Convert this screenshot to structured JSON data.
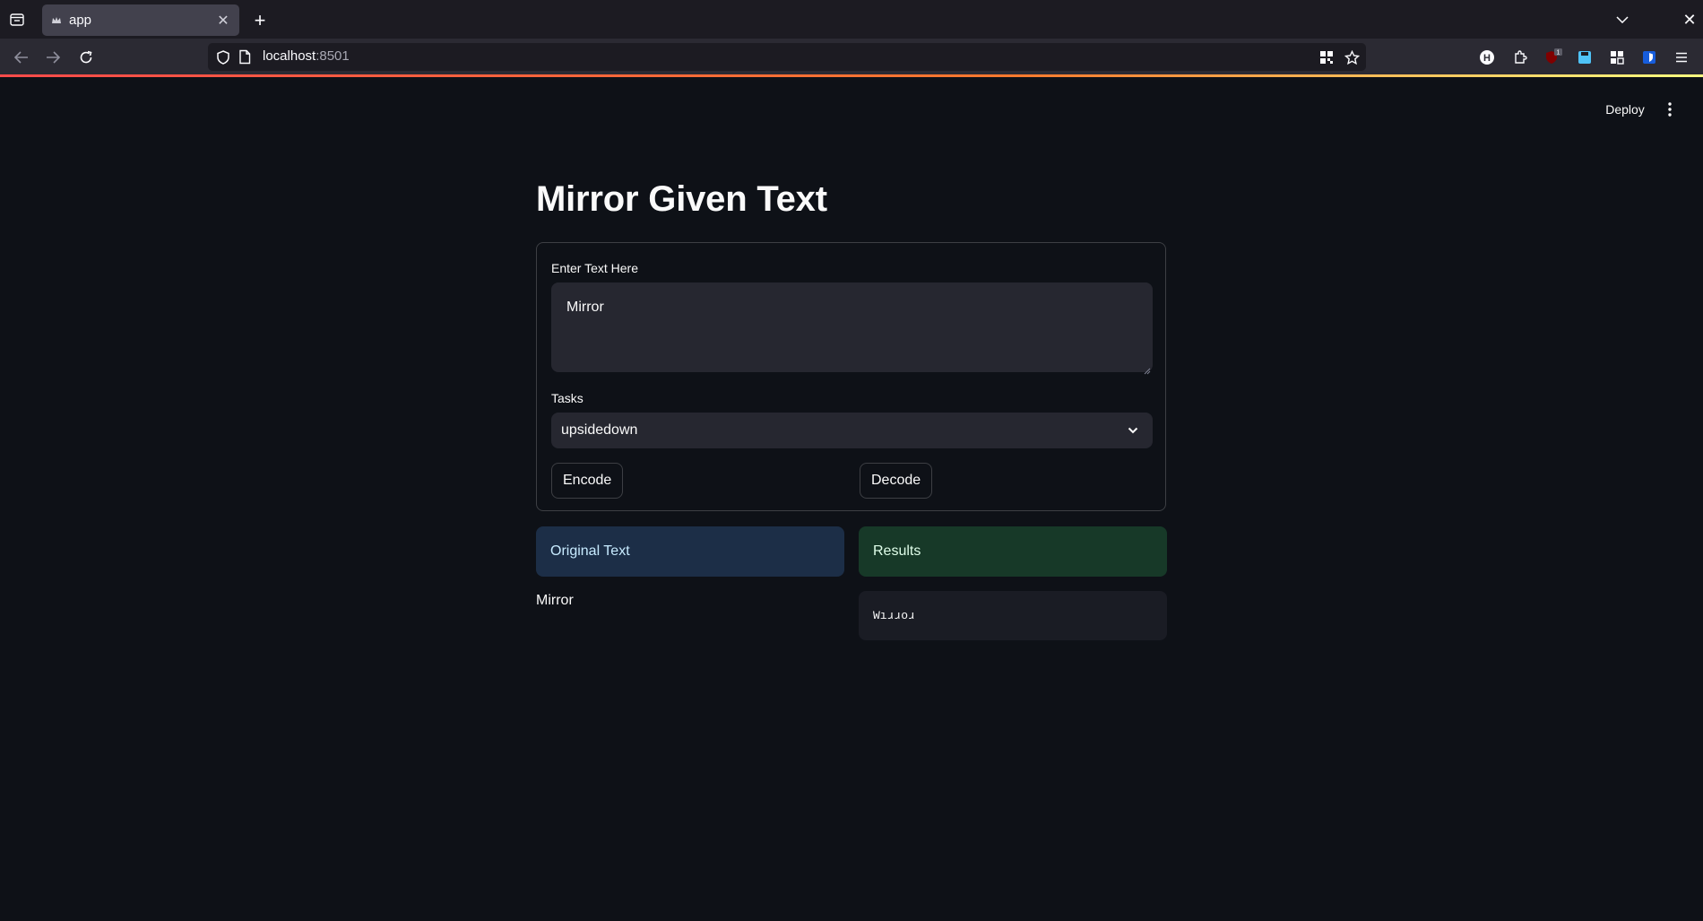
{
  "browser": {
    "tab_title": "app",
    "url_host": "localhost",
    "url_port": ":8501",
    "icons": {
      "tab_list": "tab-list-icon",
      "favicon": "streamlit-crown-icon",
      "tab_close": "close-icon",
      "new_tab": "plus-icon",
      "back": "arrow-left-icon",
      "forward": "arrow-right-icon",
      "reload": "reload-icon",
      "tracking": "shield-icon",
      "page": "page-icon",
      "qr": "qr-code-icon",
      "bookmark": "star-icon",
      "extensions_menu": "hamburger-icon"
    },
    "extension_badge": "1"
  },
  "app": {
    "deploy_label": "Deploy",
    "title": "Mirror Given Text",
    "input_label": "Enter Text Here",
    "input_value": "Mirror",
    "tasks_label": "Tasks",
    "tasks_selected": "upsidedown",
    "encode_label": "Encode",
    "decode_label": "Decode",
    "original_header": "Original Text",
    "results_header": "Results",
    "original_value": "Mirror",
    "result_value": "Wıɹɹoɹ"
  },
  "colors": {
    "background": "#0e1117",
    "accent": "#ff4b4b",
    "info_bg": "#1c2e47",
    "success_bg": "#173928",
    "input_bg": "#262730"
  }
}
